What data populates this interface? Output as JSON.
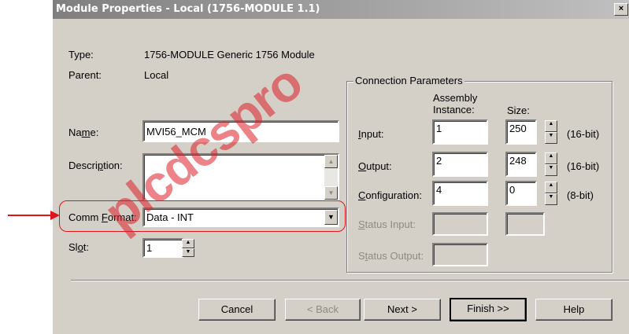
{
  "window": {
    "title": "Module Properties - Local (1756-MODULE 1.1)",
    "close": "×"
  },
  "info": {
    "type_label": "Type:",
    "type_value": "1756-MODULE Generic 1756 Module",
    "parent_label": "Parent:",
    "parent_value": "Local"
  },
  "form": {
    "name_label_pre": "Na",
    "name_label_u": "m",
    "name_label_post": "e:",
    "name_value": "MVI56_MCM",
    "description_label_pre": "Descri",
    "description_label_u": "p",
    "description_label_post": "tion:",
    "description_value": "",
    "comm_label_pre": "Comm ",
    "comm_label_u": "F",
    "comm_label_post": "ormat:",
    "comm_value": "Data - INT",
    "slot_label_pre": "Sl",
    "slot_label_u": "o",
    "slot_label_post": "t:",
    "slot_value": "1"
  },
  "connection": {
    "group_title": "Connection Parameters",
    "col_assembly": "Assembly",
    "col_instance": "Instance:",
    "col_size": "Size:",
    "rows": [
      {
        "label_u": "I",
        "label_post": "nput:",
        "instance": "1",
        "size": "250",
        "unit": "(16-bit)"
      },
      {
        "label_u": "O",
        "label_post": "utput:",
        "instance": "2",
        "size": "248",
        "unit": "(16-bit)"
      },
      {
        "label_u": "C",
        "label_post": "onfiguration:",
        "instance": "4",
        "size": "0",
        "unit": "(8-bit)"
      }
    ],
    "status_input": {
      "label_u": "S",
      "label_post": "tatus Input:"
    },
    "status_output": {
      "label_pre": "S",
      "label_u": "t",
      "label_post": "atus Output:"
    }
  },
  "buttons": {
    "cancel": "Cancel",
    "back": "< Back",
    "next": "Next >",
    "finish": "Finish >>",
    "help": "Help"
  },
  "watermark": "plcdcspro",
  "colors": {
    "annotation": "#e0151b",
    "dialog_bg": "#d4d0c8"
  }
}
